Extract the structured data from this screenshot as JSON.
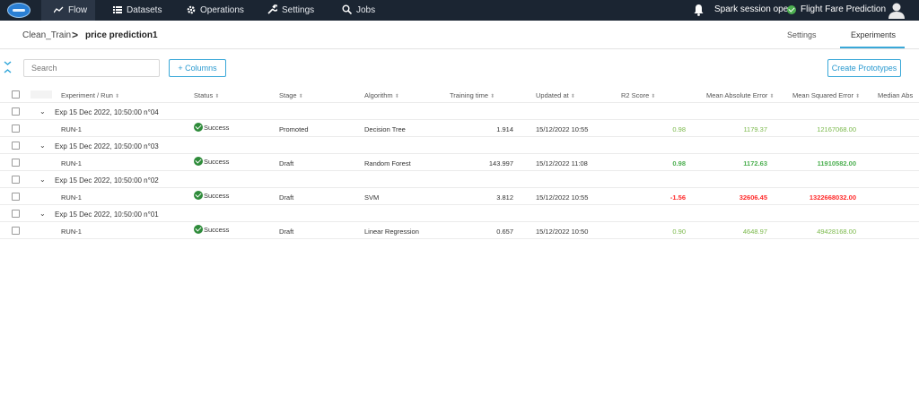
{
  "nav": {
    "items": [
      {
        "label": "Flow",
        "icon": "trend-icon"
      },
      {
        "label": "Datasets",
        "icon": "list-icon"
      },
      {
        "label": "Operations",
        "icon": "gear-icon"
      },
      {
        "label": "Settings",
        "icon": "wrench-icon"
      },
      {
        "label": "Jobs",
        "icon": "search-gear-icon"
      }
    ],
    "active": "Flow",
    "spark_status": "Spark session open",
    "project_name": "Flight Fare Prediction"
  },
  "breadcrumb": {
    "parent": "Clean_Train",
    "separator": ">",
    "current": "price prediction1"
  },
  "tabs": [
    {
      "label": "Settings",
      "active": false
    },
    {
      "label": "Experiments",
      "active": true
    }
  ],
  "toolbar": {
    "search_placeholder": "Search",
    "columns_label": "+ Columns",
    "create_prototypes_label": "Create Prototypes"
  },
  "table": {
    "columns": [
      "Experiment / Run",
      "Status",
      "Stage",
      "Algorithm",
      "Training time",
      "Updated at",
      "R2 Score",
      "Mean Absolute Error",
      "Mean Squared Error",
      "Median Abs"
    ],
    "groups": [
      {
        "name": "Exp 15 Dec 2022, 10:50:00 n°04",
        "run": {
          "name": "RUN-1",
          "status": "Success",
          "stage": "Promoted",
          "algorithm": "Decision Tree",
          "training_time": "1.914",
          "updated_at": "15/12/2022 10:55",
          "r2": "0.98",
          "mae": "1179.37",
          "mse": "12167068.00",
          "style": "light"
        }
      },
      {
        "name": "Exp 15 Dec 2022, 10:50:00 n°03",
        "run": {
          "name": "RUN-1",
          "status": "Success",
          "stage": "Draft",
          "algorithm": "Random Forest",
          "training_time": "143.997",
          "updated_at": "15/12/2022 11:08",
          "r2": "0.98",
          "mae": "1172.63",
          "mse": "11910582.00",
          "style": "best"
        }
      },
      {
        "name": "Exp 15 Dec 2022, 10:50:00 n°02",
        "run": {
          "name": "RUN-1",
          "status": "Success",
          "stage": "Draft",
          "algorithm": "SVM",
          "training_time": "3.812",
          "updated_at": "15/12/2022 10:55",
          "r2": "-1.56",
          "mae": "32606.45",
          "mse": "1322668032.00",
          "style": "worst"
        }
      },
      {
        "name": "Exp 15 Dec 2022, 10:50:00 n°01",
        "run": {
          "name": "RUN-1",
          "status": "Success",
          "stage": "Draft",
          "algorithm": "Linear Regression",
          "training_time": "0.657",
          "updated_at": "15/12/2022 10:50",
          "r2": "0.90",
          "mae": "4648.97",
          "mse": "49428168.00",
          "style": "light"
        }
      }
    ]
  },
  "colors": {
    "nav_bg": "#1b2532",
    "accent": "#3aa8d8",
    "success": "#2e8b3a",
    "metric_best": "#4caf50",
    "metric_light": "#7ab84a",
    "metric_worst": "#ff2a2a"
  }
}
